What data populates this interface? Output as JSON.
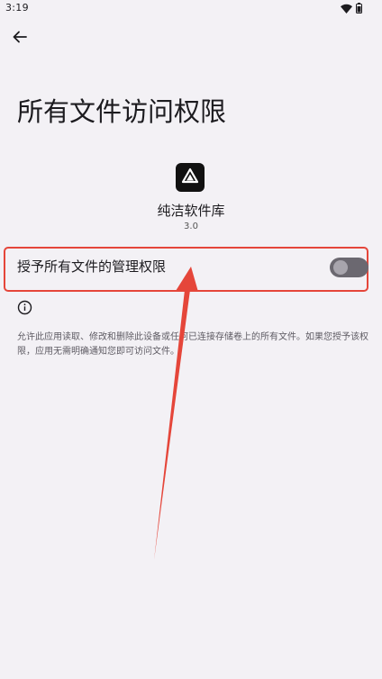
{
  "status_bar": {
    "time": "3:19",
    "icons": [
      "wifi-icon",
      "battery-icon"
    ]
  },
  "toolbar": {
    "back_icon": "arrow-left-icon"
  },
  "page": {
    "title": "所有文件访问权限"
  },
  "app": {
    "icon": "app-logo-icon",
    "name": "纯洁软件库",
    "version": "3.0"
  },
  "permission": {
    "label": "授予所有文件的管理权限",
    "enabled": false
  },
  "info": {
    "icon": "info-icon",
    "description": "允许此应用读取、修改和删除此设备或任何已连接存储卷上的所有文件。如果您授予该权限，应用无需明确通知您即可访问文件。"
  },
  "colors": {
    "background": "#f3f1f5",
    "annotation": "#e5463a",
    "toggle_track": "#6b6870",
    "toggle_thumb": "#a8a5ad"
  }
}
